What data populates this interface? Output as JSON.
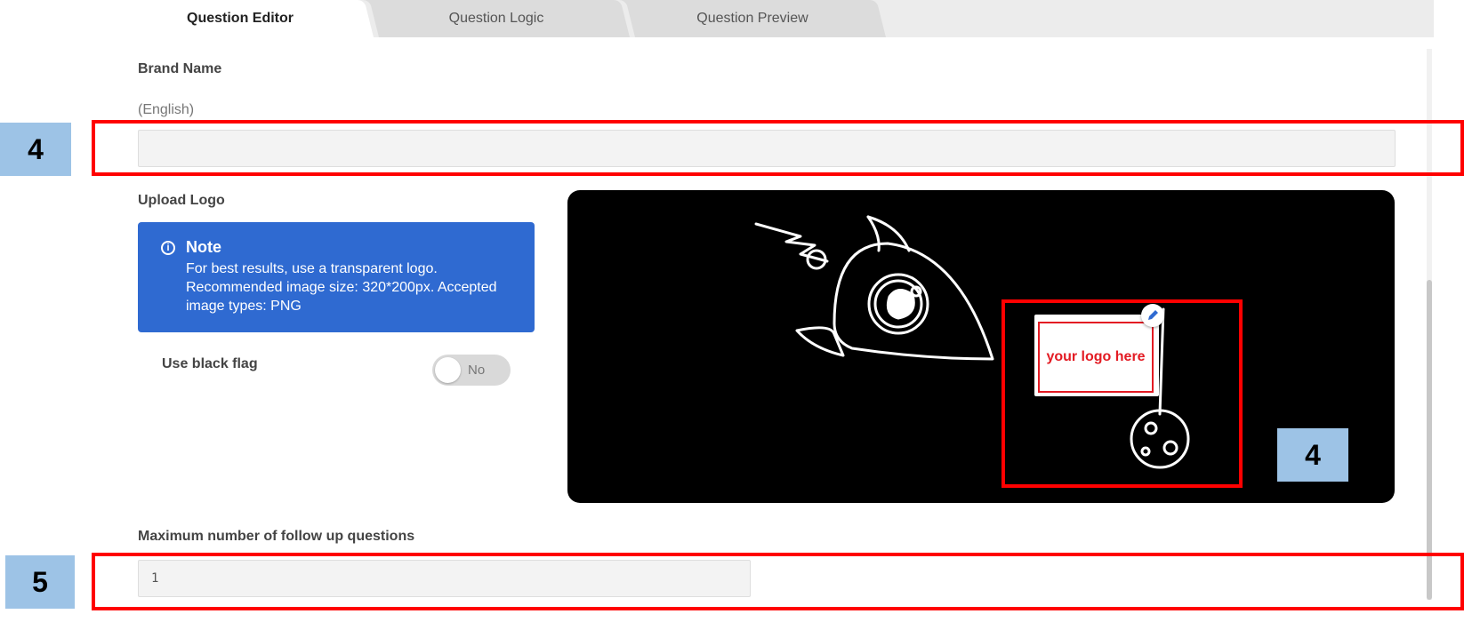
{
  "tabs": [
    {
      "label": "Question Editor",
      "active": true
    },
    {
      "label": "Question Logic",
      "active": false
    },
    {
      "label": "Question Preview",
      "active": false
    }
  ],
  "brand": {
    "label": "Brand Name",
    "language": "(English)",
    "value": ""
  },
  "upload_logo": {
    "label": "Upload Logo",
    "note_title": "Note",
    "note_line1": "For best results, use a transparent logo.",
    "note_line2": "Recommended image size: 320*200px. Accepted",
    "note_line3": "image types: PNG"
  },
  "black_flag": {
    "label": "Use black flag",
    "state": "No"
  },
  "preview": {
    "placeholder_text": "your logo here"
  },
  "followups": {
    "label": "Maximum number of follow up questions",
    "value": "1"
  },
  "callouts": {
    "brand_input": "4",
    "logo_area": "4",
    "followups_input": "5"
  },
  "colors": {
    "accent": "#2f6ad1",
    "highlight": "#ff0000",
    "callout_bg": "#9dc3e6"
  }
}
